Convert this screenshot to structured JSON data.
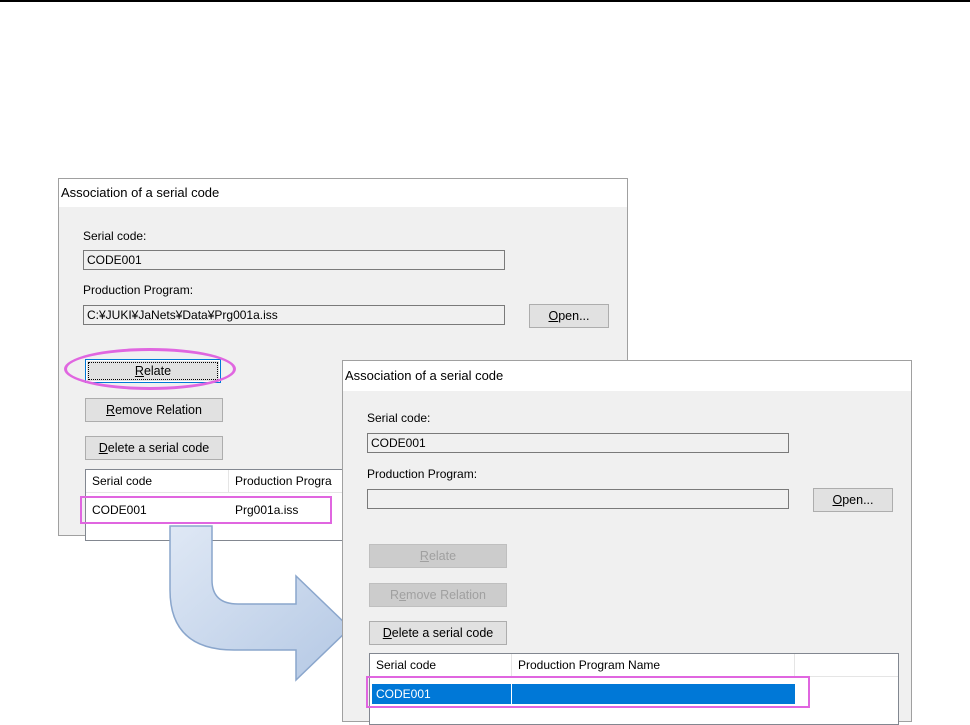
{
  "dialog_before": {
    "title": "Association of a serial code",
    "serial_label": "Serial code:",
    "serial_value": "CODE001",
    "program_label": "Production Program:",
    "program_value": "C:¥JUKI¥JaNets¥Data¥Prg001a.iss",
    "open_button": {
      "mnemonic": "O",
      "rest": "pen..."
    },
    "relate_button": {
      "mnemonic": "R",
      "rest": "elate"
    },
    "remove_button": {
      "pre": "",
      "mnemonic": "R",
      "rest": "emove Relation"
    },
    "delete_button": {
      "mnemonic": "D",
      "rest": "elete a serial code"
    },
    "list": {
      "columns": [
        "Serial code",
        "Production Progra"
      ],
      "rows": [
        {
          "serial": "CODE001",
          "program": "Prg001a.iss"
        }
      ]
    }
  },
  "dialog_after": {
    "title": "Association of a serial code",
    "serial_label": "Serial code:",
    "serial_value": "CODE001",
    "program_label": "Production Program:",
    "program_value": "",
    "open_button": {
      "mnemonic": "O",
      "rest": "pen..."
    },
    "relate_button": {
      "mnemonic": "R",
      "rest": "elate"
    },
    "remove_button": {
      "pre": "R",
      "mnemonic": "e",
      "rest": "move Relation"
    },
    "delete_button": {
      "mnemonic": "D",
      "rest": "elete a serial code"
    },
    "list": {
      "columns": [
        "Serial code",
        "Production Program Name"
      ],
      "rows": [
        {
          "serial": "CODE001",
          "program": ""
        }
      ]
    }
  },
  "colors": {
    "highlight": "#e066e0",
    "selection": "#0078d7",
    "arrow_fill": "#c9d8ec",
    "arrow_stroke": "#8aa6cc"
  },
  "icons": [
    "curved-arrow-icon"
  ]
}
